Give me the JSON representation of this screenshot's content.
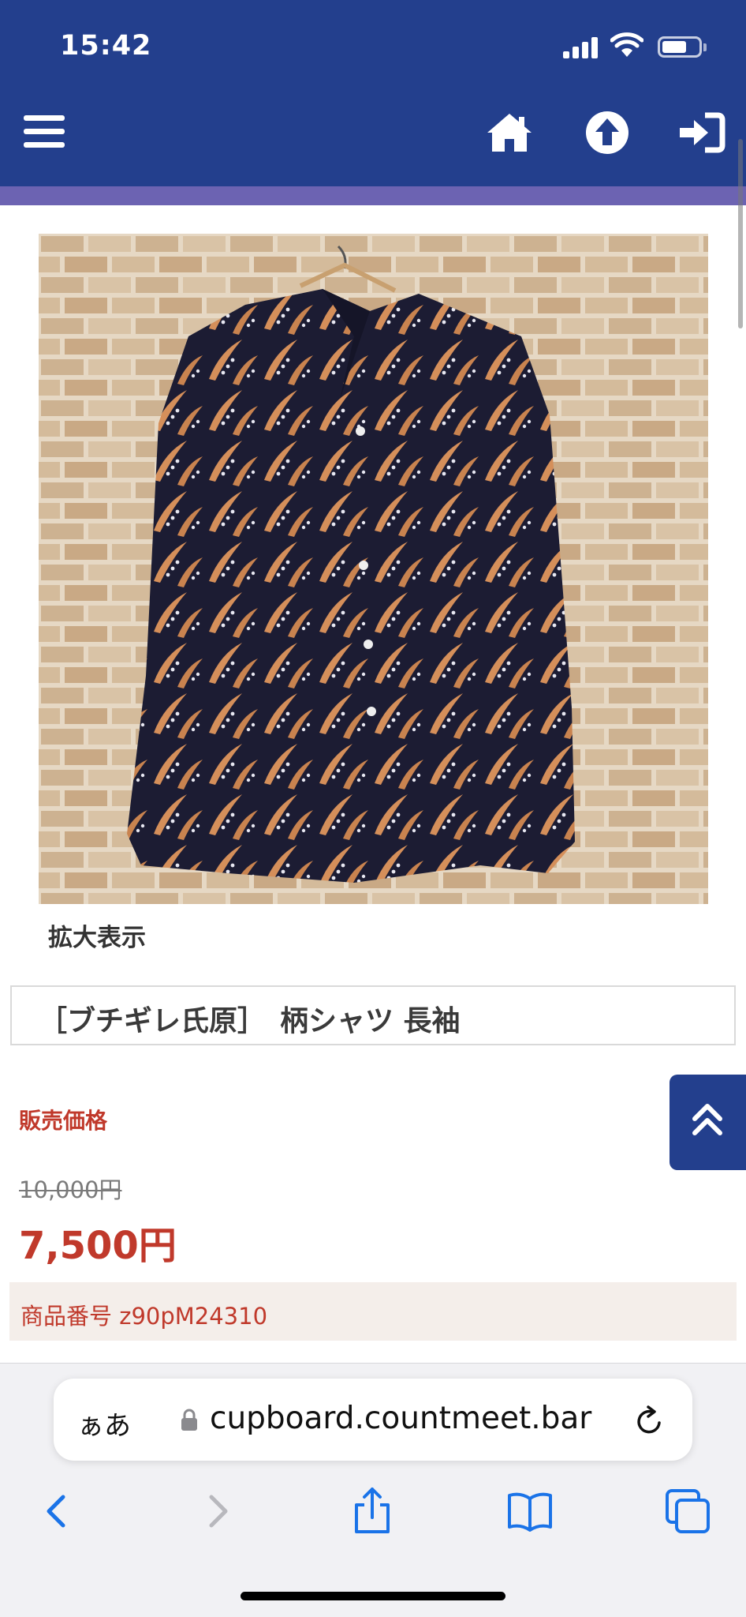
{
  "status_bar": {
    "time": "15:42"
  },
  "header": {
    "menu_icon": "hamburger-icon",
    "home_icon": "home-icon",
    "up_icon": "arrow-up-circle-icon",
    "login_icon": "sign-in-icon",
    "colors": {
      "header_bg": "#233f8d",
      "accent_bar": "#6c63b2"
    }
  },
  "product": {
    "image_alt": "patterned long-sleeve shirt on hanger",
    "zoom_label": "拡大表示",
    "title": "［ブチギレ氏原］　柄シャツ 長袖",
    "price_label": "販売価格",
    "original_price": "10,000円",
    "sale_price": "7,500円",
    "product_code": "商品番号 z90pM24310",
    "colors": {
      "price": "#c0392b",
      "code_bg": "#f4eeea"
    }
  },
  "back_to_top_icon": "double-chevron-up-icon",
  "browser": {
    "aa_label": "ぁあ",
    "url": "cupboard.countmeet.bar",
    "toolbar": [
      "back-icon",
      "forward-icon",
      "share-icon",
      "bookmarks-icon",
      "tabs-icon"
    ]
  }
}
